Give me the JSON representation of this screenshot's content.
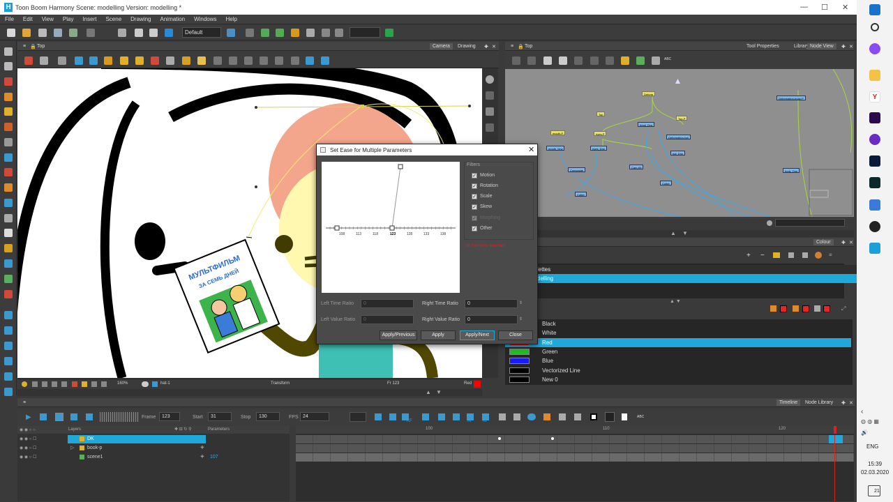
{
  "window": {
    "title": "Toon Boom Harmony Scene: modelling Version: modelling *",
    "logo_letter": "H"
  },
  "menu": [
    "File",
    "Edit",
    "View",
    "Play",
    "Insert",
    "Scene",
    "Drawing",
    "Animation",
    "Windows",
    "Help"
  ],
  "toolbar": {
    "workspace": "Default"
  },
  "camera_panel": {
    "title": "Top",
    "tabs": [
      "Camera",
      "Drawing"
    ]
  },
  "artwork": {
    "book_line1": "МУЛЬТФИЛЬМ",
    "book_line2": "ЗА СЕМЬ ДНЕЙ"
  },
  "camera_status": {
    "zoom": "160%",
    "drawing": "hat-1",
    "tool": "Transform",
    "frame": "Fr 123",
    "colour": "Red"
  },
  "node_panel": {
    "title": "Top",
    "tabs": [
      "Tool Properties",
      "Library",
      "Node View"
    ],
    "abc": "ABC"
  },
  "nodes": [
    {
      "label": "Deform",
      "kind": "y"
    },
    {
      "label": "Deformation-body-P",
      "kind": "b"
    },
    {
      "label": "Top",
      "kind": "y"
    },
    {
      "label": "Top-P",
      "kind": "y"
    },
    {
      "label": "head_Drw",
      "kind": "b"
    },
    {
      "label": "mouth-P",
      "kind": "y"
    },
    {
      "label": "eyes-P",
      "kind": "y"
    },
    {
      "label": "Deformation-hat",
      "kind": "b"
    },
    {
      "label": "mouth_Drw",
      "kind": "b"
    },
    {
      "label": "eyes_Drw",
      "kind": "b"
    },
    {
      "label": "hat_Drw",
      "kind": "b"
    },
    {
      "label": "Composite",
      "kind": "b"
    },
    {
      "label": "Cam-Kit",
      "kind": "b"
    },
    {
      "label": "body_Drw",
      "kind": "b"
    },
    {
      "label": "Cutter",
      "kind": "b"
    },
    {
      "label": "Cutter",
      "kind": "b"
    }
  ],
  "colour_panel": {
    "title": "Colour",
    "palette_header": "lettes",
    "palette_selected": "delling",
    "swatches": [
      {
        "name": "Black",
        "color": "#000000"
      },
      {
        "name": "White",
        "color": "#ffffff"
      },
      {
        "name": "Red",
        "color": "#ff0000",
        "selected": true
      },
      {
        "name": "Green",
        "color": "#19c21f"
      },
      {
        "name": "Blue",
        "color": "#1a1aff"
      },
      {
        "name": "Vectorized Line",
        "color": "#000000"
      },
      {
        "name": "New 0",
        "color": "#000000"
      }
    ]
  },
  "dialog": {
    "title": "Set Ease for Multiple Parameters",
    "filters_title": "Filters",
    "filters": [
      {
        "label": "Motion",
        "checked": true
      },
      {
        "label": "Rotation",
        "checked": true
      },
      {
        "label": "Scale",
        "checked": true
      },
      {
        "label": "Skew",
        "checked": true
      },
      {
        "label": "Morphing",
        "checked": true,
        "disabled": true
      },
      {
        "label": "Other",
        "checked": true
      }
    ],
    "functions_selected": "(3) functions selected",
    "graph_ticks": [
      "108",
      "113",
      "118",
      "123",
      "128",
      "133",
      "138"
    ],
    "left_time_label": "Left Time Ratio",
    "left_time_value": "0",
    "right_time_label": "Right Time Ratio",
    "right_time_value": "0",
    "left_value_label": "Left Value Ratio",
    "left_value_value": "0",
    "right_value_label": "Right Value Ratio",
    "right_value_value": "0",
    "buttons": [
      "Apply/Previous",
      "Apply",
      "Apply/Next",
      "Close"
    ]
  },
  "timeline": {
    "tabs": [
      "Timeline",
      "Node Library"
    ],
    "frame_label": "Frame",
    "frame_value": "123",
    "start_label": "Start",
    "start_value": "31",
    "stop_label": "Stop",
    "stop_value": "130",
    "fps_label": "FPS",
    "fps_value": "24",
    "layers_header": "Layers",
    "params_header": "Parameters",
    "layers": [
      {
        "name": "DK",
        "value": ""
      },
      {
        "name": "book-p",
        "value": ""
      },
      {
        "name": "scene1",
        "value": "107"
      }
    ],
    "ruler": [
      "100",
      "110",
      "120"
    ],
    "kf_label": "KF",
    "abc": "ABC"
  },
  "taskbar": {
    "lang": "ENG",
    "time": "15:39",
    "date": "02.03.2020",
    "notif_count": "21"
  }
}
